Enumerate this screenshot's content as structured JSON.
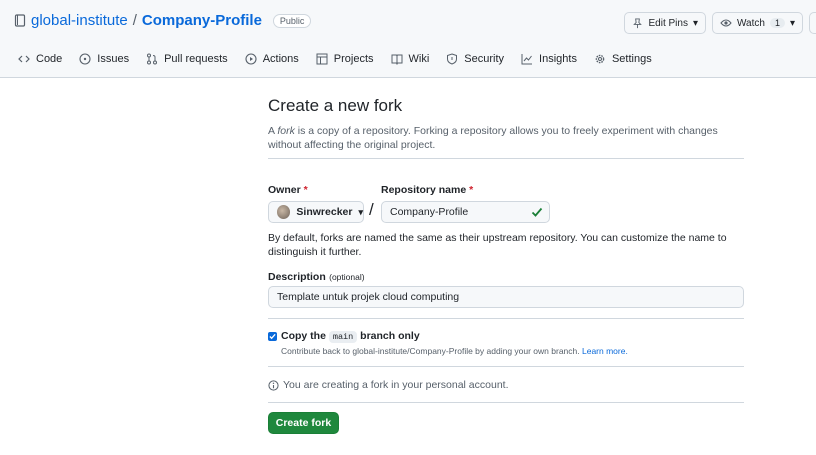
{
  "repo_header": {
    "owner": "global-institute",
    "separator": "/",
    "repo": "Company-Profile",
    "visibility": "Public"
  },
  "header_buttons": {
    "edit_pins": "Edit Pins",
    "watch": "Watch",
    "watch_count": "1"
  },
  "nav": [
    {
      "label": "Code",
      "icon": "code-icon"
    },
    {
      "label": "Issues",
      "icon": "issue-icon"
    },
    {
      "label": "Pull requests",
      "icon": "pull-request-icon"
    },
    {
      "label": "Actions",
      "icon": "play-icon"
    },
    {
      "label": "Projects",
      "icon": "table-icon"
    },
    {
      "label": "Wiki",
      "icon": "book-icon"
    },
    {
      "label": "Security",
      "icon": "shield-icon"
    },
    {
      "label": "Insights",
      "icon": "graph-icon"
    },
    {
      "label": "Settings",
      "icon": "gear-icon"
    }
  ],
  "form": {
    "title": "Create a new fork",
    "description_prefix": "A ",
    "description_em": "fork",
    "description_rest": " is a copy of a repository. Forking a repository allows you to freely experiment with changes without affecting the original project.",
    "owner_label": "Owner",
    "repo_name_label": "Repository name",
    "required_mark": "*",
    "owner_value": "Sinwrecker",
    "slash": "/",
    "repo_name_value": "Company-Profile",
    "naming_hint": "By default, forks are named the same as their upstream repository. You can customize the name to distinguish it further.",
    "description_label": "Description",
    "optional_label": "(optional)",
    "description_value": "Template untuk projek cloud computing",
    "copy_prefix": "Copy the",
    "copy_branch": "main",
    "copy_suffix": "branch only",
    "copy_checked": true,
    "contribute_text": "Contribute back to global-institute/Company-Profile by adding your own branch.",
    "learn_more": "Learn more.",
    "info_text": "You are creating a fork in your personal account.",
    "create_button": "Create fork"
  },
  "colors": {
    "link": "#0969da",
    "primary_button": "#1f883d",
    "check_ok": "#1a7f37",
    "required": "#cf222e"
  }
}
